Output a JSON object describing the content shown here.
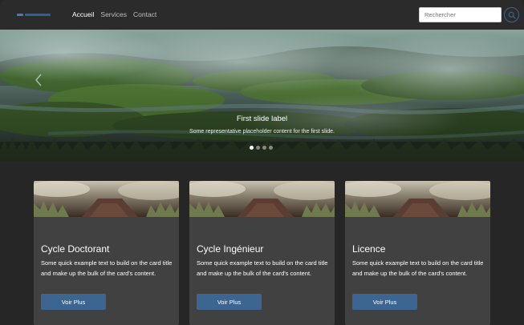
{
  "navbar": {
    "links": [
      {
        "label": "Accueil",
        "active": true
      },
      {
        "label": "Services",
        "active": false
      },
      {
        "label": "Contact",
        "active": false
      }
    ],
    "search": {
      "placeholder": "Rechercher"
    }
  },
  "carousel": {
    "slide": {
      "title": "First slide label",
      "text": "Some representative placeholder content for the first slide."
    },
    "indicator_count": 4,
    "active_index": 0
  },
  "cards": [
    {
      "title": "Cycle Doctorant",
      "text": "Some quick example text to build on the card title and make up the bulk of the card's content.",
      "button": "Voir Plus"
    },
    {
      "title": "Cycle Ingénieur",
      "text": "Some quick example text to build on the card title and make up the bulk of the card's content.",
      "button": "Voir Plus"
    },
    {
      "title": "Licence",
      "text": "Some quick example text to build on the card title and make up the bulk of the card's content.",
      "button": "Voir Plus"
    }
  ],
  "colors": {
    "page_bg": "#262626",
    "navbar_bg": "#2b2b2b",
    "card_bg": "#414141",
    "button_bg": "#3d6591",
    "brand_blue": "#2f5f96"
  }
}
